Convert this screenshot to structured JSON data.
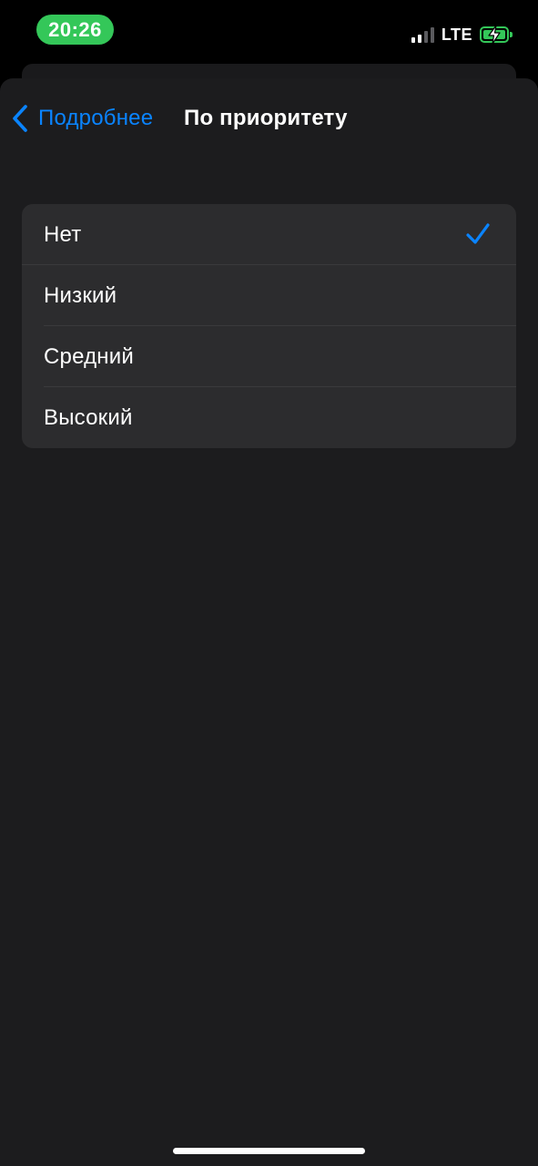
{
  "status_bar": {
    "time": "20:26",
    "network": "LTE",
    "signal_bars_active": 2,
    "signal_bars_total": 4,
    "battery_state": "charging",
    "accent_color": "#34c759"
  },
  "nav": {
    "back_label": "Подробнее",
    "title": "По приоритету",
    "accent_color": "#0a84ff"
  },
  "options": [
    {
      "label": "Нет",
      "selected": true
    },
    {
      "label": "Низкий",
      "selected": false
    },
    {
      "label": "Средний",
      "selected": false
    },
    {
      "label": "Высокий",
      "selected": false
    }
  ],
  "icons": {
    "back": "chevron-left-icon",
    "selected": "checkmark-icon",
    "battery": "battery-charging-icon",
    "signal": "cellular-signal-icon"
  }
}
